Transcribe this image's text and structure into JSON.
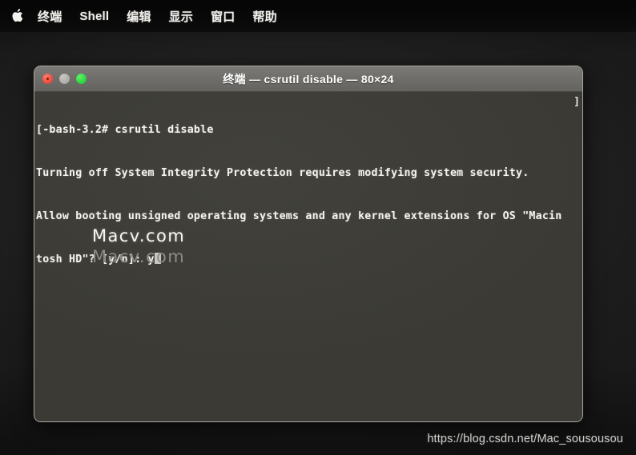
{
  "menubar": {
    "apple_icon": "apple-logo-icon",
    "items": [
      {
        "label": "终端"
      },
      {
        "label": "Shell"
      },
      {
        "label": "编辑"
      },
      {
        "label": "显示"
      },
      {
        "label": "窗口"
      },
      {
        "label": "帮助"
      }
    ]
  },
  "window": {
    "title": "终端 — csrutil disable — 80×24",
    "controls": {
      "close": "close-button",
      "minimize": "minimize-button",
      "zoom": "zoom-button"
    },
    "terminal": {
      "lines": [
        "[-bash-3.2# csrutil disable",
        "Turning off System Integrity Protection requires modifying system security.",
        "Allow booting unsigned operating systems and any kernel extensions for OS \"Macin",
        "tosh HD\"? [y/n]: y"
      ],
      "prompt": "[-bash-3.2#",
      "command": "csrutil disable",
      "input_value": "y",
      "scroll_marker": "]"
    }
  },
  "watermarks": {
    "primary": "Macv.com",
    "secondary": "Macv.com"
  },
  "footer": {
    "url": "https://blog.csdn.net/Mac_sousousou"
  },
  "colors": {
    "desktop_bg": "#1a1a1a",
    "menubar_bg": "#090909",
    "titlebar_bg": "#706f6b",
    "terminal_bg": "#3b3a34",
    "terminal_fg": "#f4f2ee",
    "close_red": "#ec4a3b",
    "minimize_gray": "#adaba5",
    "zoom_green": "#25d63a"
  }
}
